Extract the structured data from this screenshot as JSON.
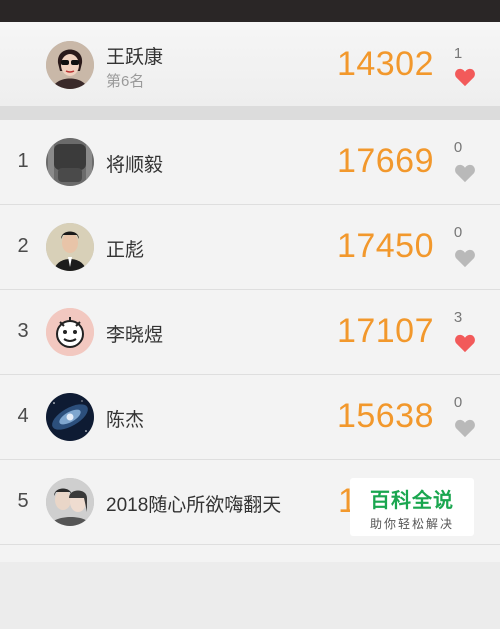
{
  "me": {
    "name": "王跃康",
    "rank_label": "第6名",
    "steps": "14302",
    "likes": "1",
    "liked": true,
    "avatar": "avatar-woman-sunglasses"
  },
  "list": [
    {
      "rank": "1",
      "name": "将顺毅",
      "steps": "17669",
      "likes": "0",
      "liked": false,
      "avatar": "avatar-car-seat"
    },
    {
      "rank": "2",
      "name": "正彪",
      "steps": "17450",
      "likes": "0",
      "liked": false,
      "avatar": "avatar-man-suit"
    },
    {
      "rank": "3",
      "name": "李晓煜",
      "steps": "17107",
      "likes": "3",
      "liked": true,
      "avatar": "avatar-cartoon-face"
    },
    {
      "rank": "4",
      "name": "陈杰",
      "steps": "15638",
      "likes": "0",
      "liked": false,
      "avatar": "avatar-galaxy"
    },
    {
      "rank": "5",
      "name": "2018随心所欲嗨翻天",
      "steps": "1",
      "likes": "",
      "liked": false,
      "avatar": "avatar-couple-photo"
    }
  ],
  "watermark": {
    "title": "百科全说",
    "subtitle": "助你轻松解决"
  },
  "colors": {
    "steps": "#f2982c",
    "heart_active": "#f25a5a",
    "heart_inactive": "#b9b9b9"
  }
}
